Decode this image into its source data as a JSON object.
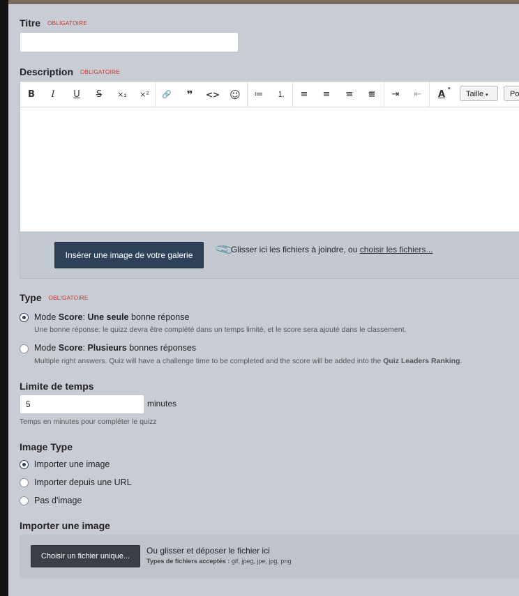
{
  "title_field": {
    "label": "Titre",
    "required": "OBLIGATOIRE",
    "value": ""
  },
  "description_field": {
    "label": "Description",
    "required": "OBLIGATOIRE"
  },
  "editor": {
    "toolbar": {
      "bold": "B",
      "italic": "I",
      "underline": "U",
      "strike": "S",
      "sub": "×₂",
      "sup": "×²",
      "link": "🔗",
      "quote": "❞",
      "code": "<>",
      "emoji": "☺",
      "ul": "≔",
      "ol": "⒈",
      "align_left": "≡",
      "align_center": "≡",
      "align_right": "≡",
      "justify": "≡",
      "indent": "⇥",
      "outdent": "⇤",
      "color": "A",
      "size_label": "Taille",
      "font_label": "Po"
    },
    "insert_image_button": "Insérer une image de votre galerie",
    "attach_text": "Glisser ici les fichiers à joindre, ou ",
    "attach_link": "choisir les fichiers..."
  },
  "type_field": {
    "label": "Type",
    "required": "OBLIGATOIRE",
    "options": [
      {
        "prefix": "Mode ",
        "bold1": "Score",
        "mid": ": ",
        "bold2": "Une seule",
        "suffix": " bonne réponse",
        "help": "Une bonne réponse: le quizz devra être complété dans un temps limité, et le score sera ajouté dans le classement.",
        "selected": true
      },
      {
        "prefix": "Mode ",
        "bold1": "Score",
        "mid": ": ",
        "bold2": "Plusieurs",
        "suffix": " bonnes réponses",
        "help": "Multiple right answers. Quiz will have a challenge time to be completed and the score will be added into the ",
        "help_bold": "Quiz Leaders Ranking",
        "help_end": ".",
        "selected": false
      }
    ]
  },
  "time_limit": {
    "label": "Limite de temps",
    "value": "5",
    "unit": "minutes",
    "help": "Temps en minutes pour compléter le quizz"
  },
  "image_type": {
    "label": "Image Type",
    "options": [
      {
        "label": "Importer une image",
        "selected": true
      },
      {
        "label": "Importer depuis une URL",
        "selected": false
      },
      {
        "label": "Pas d'image",
        "selected": false
      }
    ]
  },
  "image_upload": {
    "label": "Importer une image",
    "button": "Choisir un fichier unique...",
    "drop_text": "Ou glisser et déposer le fichier ici",
    "types_label": "Types de fichiers acceptés :",
    "types_value": " gif, jpeg, jpe, jpg, png"
  },
  "colors": {
    "primary": "#2f4158",
    "required": "#c0392b",
    "background": "#c9ccd5"
  }
}
